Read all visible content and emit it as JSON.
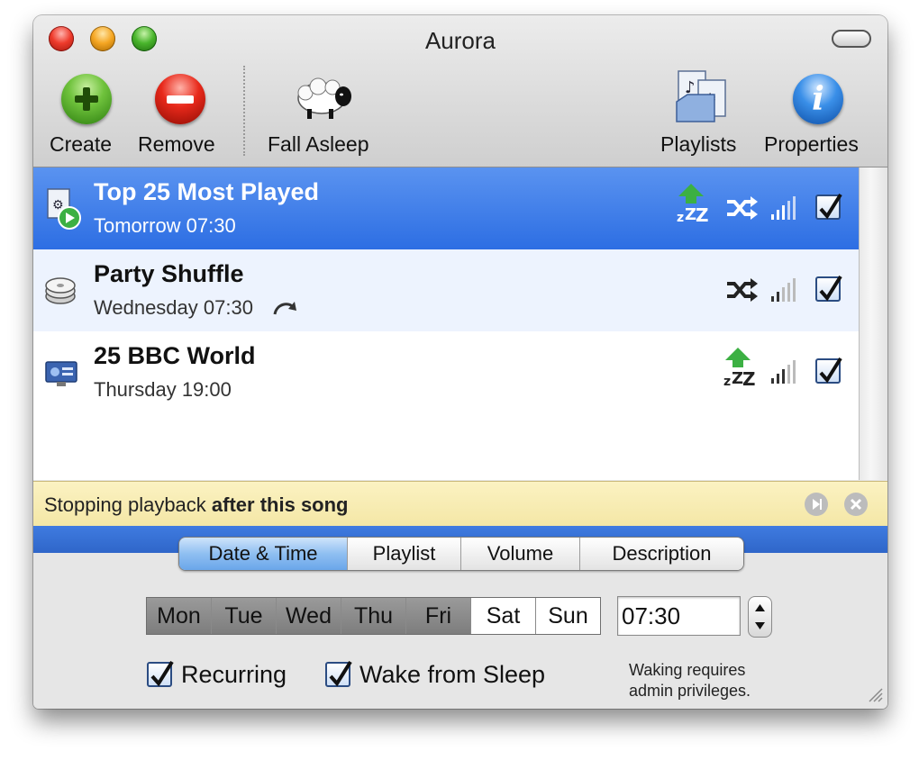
{
  "window": {
    "title": "Aurora"
  },
  "toolbar": {
    "create_label": "Create",
    "remove_label": "Remove",
    "fall_asleep_label": "Fall Asleep",
    "playlists_label": "Playlists",
    "properties_label": "Properties"
  },
  "alarms": [
    {
      "title": "Top 25 Most Played",
      "schedule": "Tomorrow 07:30",
      "icon": "smart-playlist-icon",
      "wake": true,
      "shuffle": true,
      "repeat": false,
      "enabled": true,
      "selected": true
    },
    {
      "title": "Party Shuffle",
      "schedule": "Wednesday 07:30",
      "icon": "party-shuffle-icon",
      "wake": false,
      "shuffle": true,
      "repeat": true,
      "enabled": true,
      "selected": false
    },
    {
      "title": "25 BBC World",
      "schedule": "Thursday 19:00",
      "icon": "radio-icon",
      "wake": true,
      "shuffle": false,
      "repeat": false,
      "enabled": true,
      "selected": false
    }
  ],
  "notice": {
    "prefix": "Stopping playback",
    "emphasis": "after this song"
  },
  "tabs": [
    "Date & Time",
    "Playlist",
    "Volume",
    "Description"
  ],
  "active_tab": "Date & Time",
  "days": [
    {
      "label": "Mon",
      "on": true
    },
    {
      "label": "Tue",
      "on": true
    },
    {
      "label": "Wed",
      "on": true
    },
    {
      "label": "Thu",
      "on": true
    },
    {
      "label": "Fri",
      "on": true
    },
    {
      "label": "Sat",
      "on": false
    },
    {
      "label": "Sun",
      "on": false
    }
  ],
  "time": "07:30",
  "options": {
    "recurring_label": "Recurring",
    "recurring_checked": true,
    "wake_label": "Wake from Sleep",
    "wake_checked": true,
    "admin_note_line1": "Waking requires",
    "admin_note_line2": "admin privileges."
  },
  "colors": {
    "selection": "#2d6ee3",
    "notice_bg": "#f6e9ac",
    "active_tab": "#8fbff1",
    "wake_arrow": "#3cb043"
  }
}
